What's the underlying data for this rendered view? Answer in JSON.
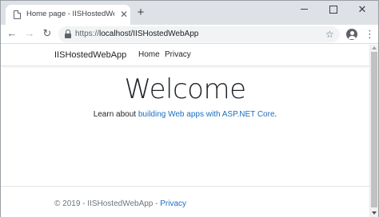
{
  "browser": {
    "tab_title": "Home page - IISHostedWebApp",
    "tab_close_glyph": "✕",
    "new_tab_glyph": "+",
    "window_close_glyph": "✕",
    "back_glyph": "←",
    "forward_glyph": "→",
    "reload_glyph": "↻",
    "url_scheme": "https://",
    "url_host": "localhost/IISHostedWebApp",
    "bookmark_glyph": "☆",
    "menu_glyph": "⋮",
    "icons": [
      "page-icon",
      "close-icon",
      "plus-icon",
      "minimize-icon",
      "maximize-icon",
      "close-icon",
      "back-arrow-icon",
      "forward-arrow-icon",
      "reload-icon",
      "lock-icon",
      "star-icon",
      "profile-icon",
      "menu-icon"
    ]
  },
  "site": {
    "brand": "IISHostedWebApp",
    "nav": {
      "home": "Home",
      "privacy": "Privacy"
    },
    "heading": "Welcome",
    "learn_prefix": "Learn about ",
    "learn_link": "building Web apps with ASP.NET Core",
    "learn_suffix": ".",
    "footer": {
      "text": "© 2019 - IISHostedWebApp - ",
      "privacy_link": "Privacy"
    }
  },
  "colors": {
    "link": "#1b6ec2",
    "text": "#212529",
    "muted": "#6c757d",
    "tabstrip": "#dee1e6"
  }
}
